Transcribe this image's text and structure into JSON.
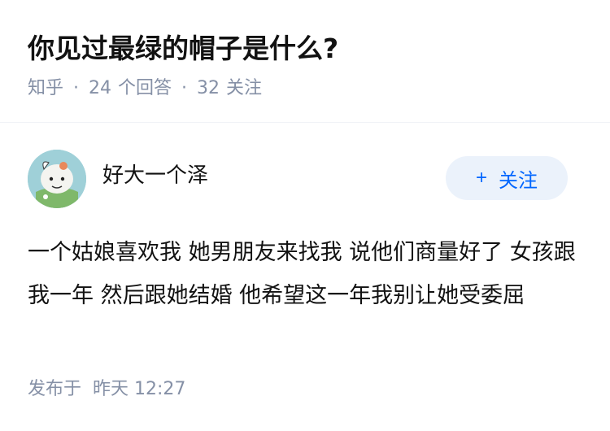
{
  "question": {
    "title": "你见过最绿的帽子是什么?",
    "source": "知乎",
    "answer_count": "24",
    "answer_label": "个回答",
    "follower_count": "32",
    "follower_label": "关注"
  },
  "author": {
    "name": "好大一个泽",
    "follow_label": "关注",
    "follow_icon": "plus-icon",
    "accent_color": "#0066ff"
  },
  "answer": {
    "text": "一个姑娘喜欢我 她男朋友来找我 说他们商量好了 女孩跟我一年 然后跟她结婚 他希望这一年我别让她受委屈",
    "publish_label": "发布于",
    "publish_time": "昨天 12:27"
  }
}
